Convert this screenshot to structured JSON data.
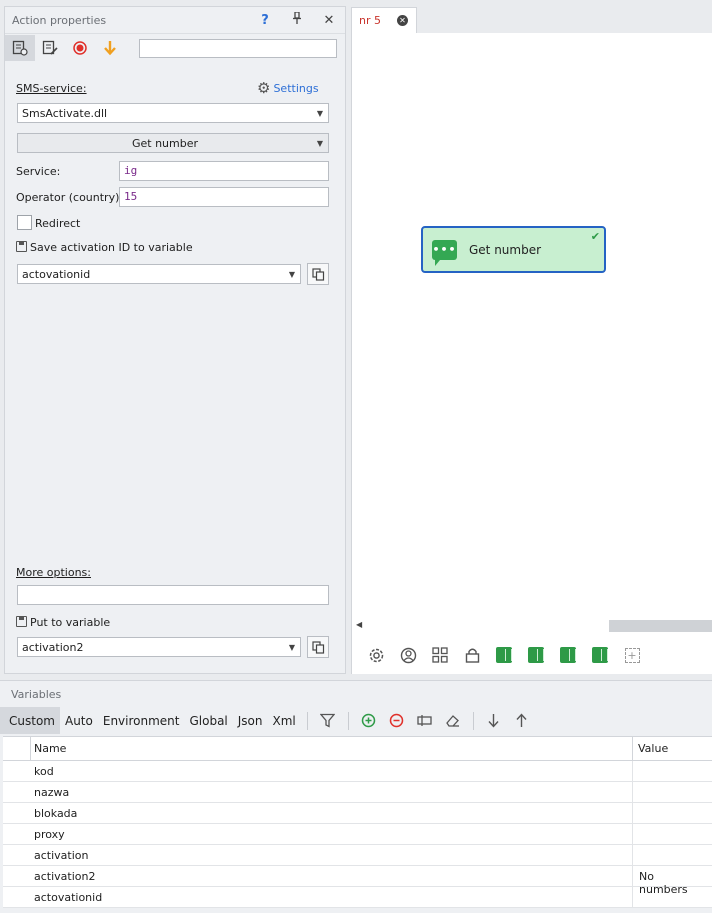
{
  "action_panel": {
    "title": "Action properties",
    "help": "?",
    "pin": "📌",
    "close": "✕",
    "search_value": "",
    "sms_service_label": "SMS-service:",
    "settings_label": "Settings",
    "sms_service_value": "SmsActivate.dll",
    "method_value": "Get number",
    "service_label": "Service:",
    "service_value": "ig",
    "operator_label": "Operator (country):",
    "operator_value": "15",
    "redirect_label": "Redirect",
    "save_id_label": "Save activation ID to variable",
    "save_id_value": "actovationid",
    "more_options_label": "More options:",
    "more_options_value": "",
    "put_to_variable_label": "Put to variable",
    "put_to_variable_value": "activation2"
  },
  "canvas": {
    "tab_label": "nr 5",
    "node_label": "Get number",
    "node_icon": "•••"
  },
  "variables": {
    "title": "Variables",
    "tabs": [
      "Custom",
      "Auto",
      "Environment",
      "Global",
      "Json",
      "Xml"
    ],
    "columns": {
      "name": "Name",
      "value": "Value"
    },
    "rows": [
      {
        "name": "kod",
        "value": ""
      },
      {
        "name": "nazwa",
        "value": ""
      },
      {
        "name": "blokada",
        "value": ""
      },
      {
        "name": "proxy",
        "value": ""
      },
      {
        "name": "activation",
        "value": ""
      },
      {
        "name": "activation2",
        "value": "No numbers"
      },
      {
        "name": "actovationid",
        "value": ""
      }
    ]
  },
  "colors": {
    "accent": "#2563c4",
    "node_fill": "#c8efd0",
    "success": "#2e9a47",
    "record": "#e0302a",
    "arrow": "#f0a020"
  }
}
